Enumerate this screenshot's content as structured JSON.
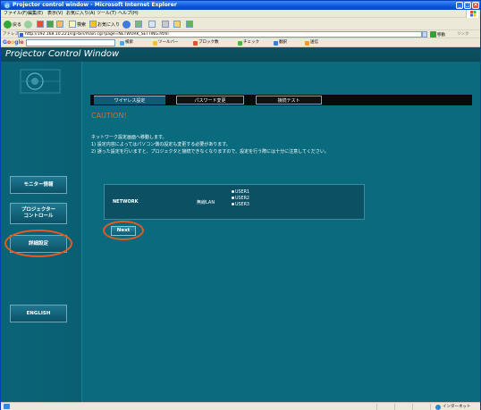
{
  "browser": {
    "title": "Projector control window - Microsoft Internet Explorer",
    "menu": [
      "ファイル(F)",
      "編集(E)",
      "表示(V)",
      "お気に入り(A)",
      "ツール(T)",
      "ヘルプ(H)"
    ],
    "toolbar": {
      "back_label": "戻る",
      "search_label": "検索",
      "favorites_label": "お気に入り"
    },
    "address": {
      "label": "アドレス(D)",
      "url": "http://192.168.10.221/cgi-bin/main.cgi?page=NETWORK_SETTING.html",
      "go_label": "移動",
      "links_label": "リンク"
    },
    "google": {
      "logo": "Google",
      "items": [
        "検索",
        "ツールバー",
        "ブロック数",
        "チェック",
        "翻訳",
        "送信"
      ]
    },
    "status": {
      "zone_label": "インターネット"
    }
  },
  "page": {
    "header_title": "Projector Control Window",
    "sidebar": {
      "items": [
        {
          "label": "モニター情報"
        },
        {
          "label": "プロジェクター\nコントロール"
        },
        {
          "label": "詳細設定"
        },
        {
          "label": "ENGLISH"
        }
      ]
    },
    "tabs": [
      {
        "label": "ワイヤレス設定",
        "active": true
      },
      {
        "label": "パスワード変更",
        "active": false
      },
      {
        "label": "接続テスト",
        "active": false
      }
    ],
    "caution_title": "CAUTION!",
    "messages": [
      "ネットワーク設定画面へ移動します。",
      "1) 設定内容によってはパソコン側の設定も変更する必要があります。",
      "2) 誤った設定を行いますと、プロジェクタと接続できなくなりますので、設定を行う際には十分に注意してください。"
    ],
    "network": {
      "label": "NETWORK",
      "type": "無線LAN",
      "users": [
        "USER1",
        "USER2",
        "USER3"
      ]
    },
    "next_label": "Next"
  },
  "colors": {
    "page_bg": "#0a6a7e",
    "caution": "#e8642a",
    "highlight_oval": "#e85a22"
  }
}
